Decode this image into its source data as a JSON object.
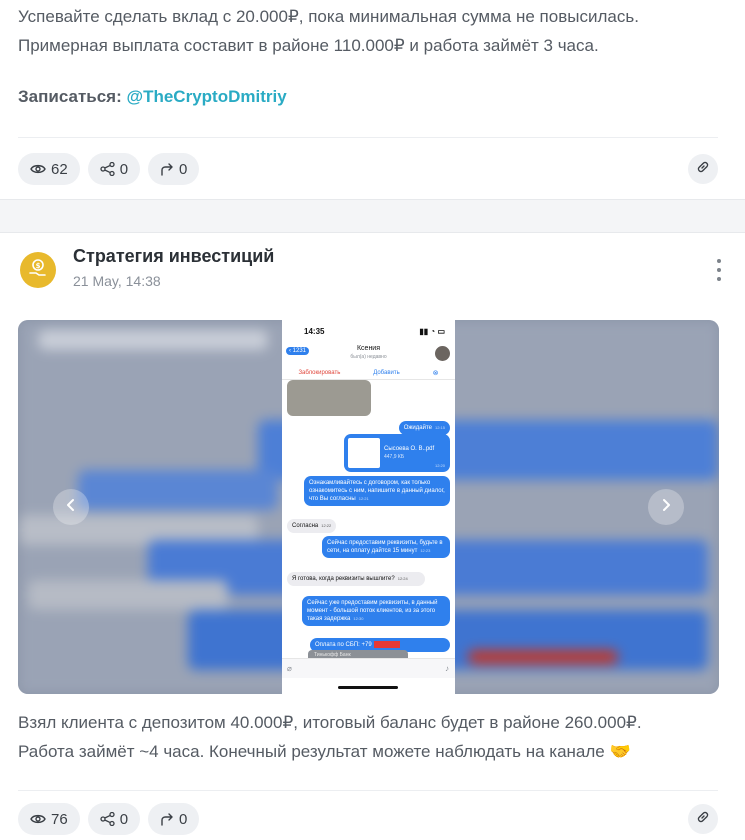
{
  "post1": {
    "line1": "Успевайте сделать вклад с 20.000₽, пока минимальная сумма не повысилась.",
    "line2": "Примерная выплата составит в районе 110.000₽ и работа займёт 3 часа.",
    "subscribe_label": "Записаться:",
    "subscribe_link": "@TheCryptoDmitriy",
    "views": "62",
    "shares": "0",
    "forwards": "0"
  },
  "post2": {
    "channel_name": "Стратегия инвестиций",
    "date": "21 May, 14:38",
    "line1": "Взял клиента с депозитом 40.000₽, итоговый баланс будет в районе 260.000₽.",
    "line2": "Работа займёт ~4 часа. Конечный результат можете наблюдать на канале",
    "emoji": "🤝",
    "views": "76",
    "shares": "0",
    "forwards": "0"
  },
  "screenshot": {
    "time": "14:35",
    "back_count": "1231",
    "contact_name": "Ксения",
    "last_seen": "был(а) недавно",
    "block_label": "Заблокировать",
    "add_label": "Добавить",
    "messages": [
      {
        "dir": "out",
        "text": "Ожидайте",
        "time": "12:15"
      },
      {
        "dir": "out",
        "text": "Сысоева О. В..pdf",
        "size": "447,9 КБ",
        "time": "12:20"
      },
      {
        "dir": "out",
        "text": "Ознакамливайтесь с договором, как только ознакомитесь с ним, напишите в данный диалог, что Вы согласны",
        "time": "12:21"
      },
      {
        "dir": "in",
        "text": "Согласна",
        "time": "12:22"
      },
      {
        "dir": "out",
        "text": "Сейчас предоставим реквизиты, будьте в сети, на оплату дайтся 15 минут",
        "time": "12:23"
      },
      {
        "dir": "in",
        "text": "Я готова, когда реквизиты вышлите?",
        "time": "12:24"
      },
      {
        "dir": "out",
        "text": "Сейчас уже предоставим реквизиты, в данный момент - большой поток клиентов, из за этого такая задержка",
        "time": "12:30"
      },
      {
        "dir": "out",
        "text": "Оплата по СБП: +79",
        "time": ""
      }
    ],
    "bank_label": "Тинькофф Банк"
  },
  "colors": {
    "link": "#2aabc4",
    "avatar": "#e8b92c",
    "tg_blue": "#2f80ed"
  }
}
